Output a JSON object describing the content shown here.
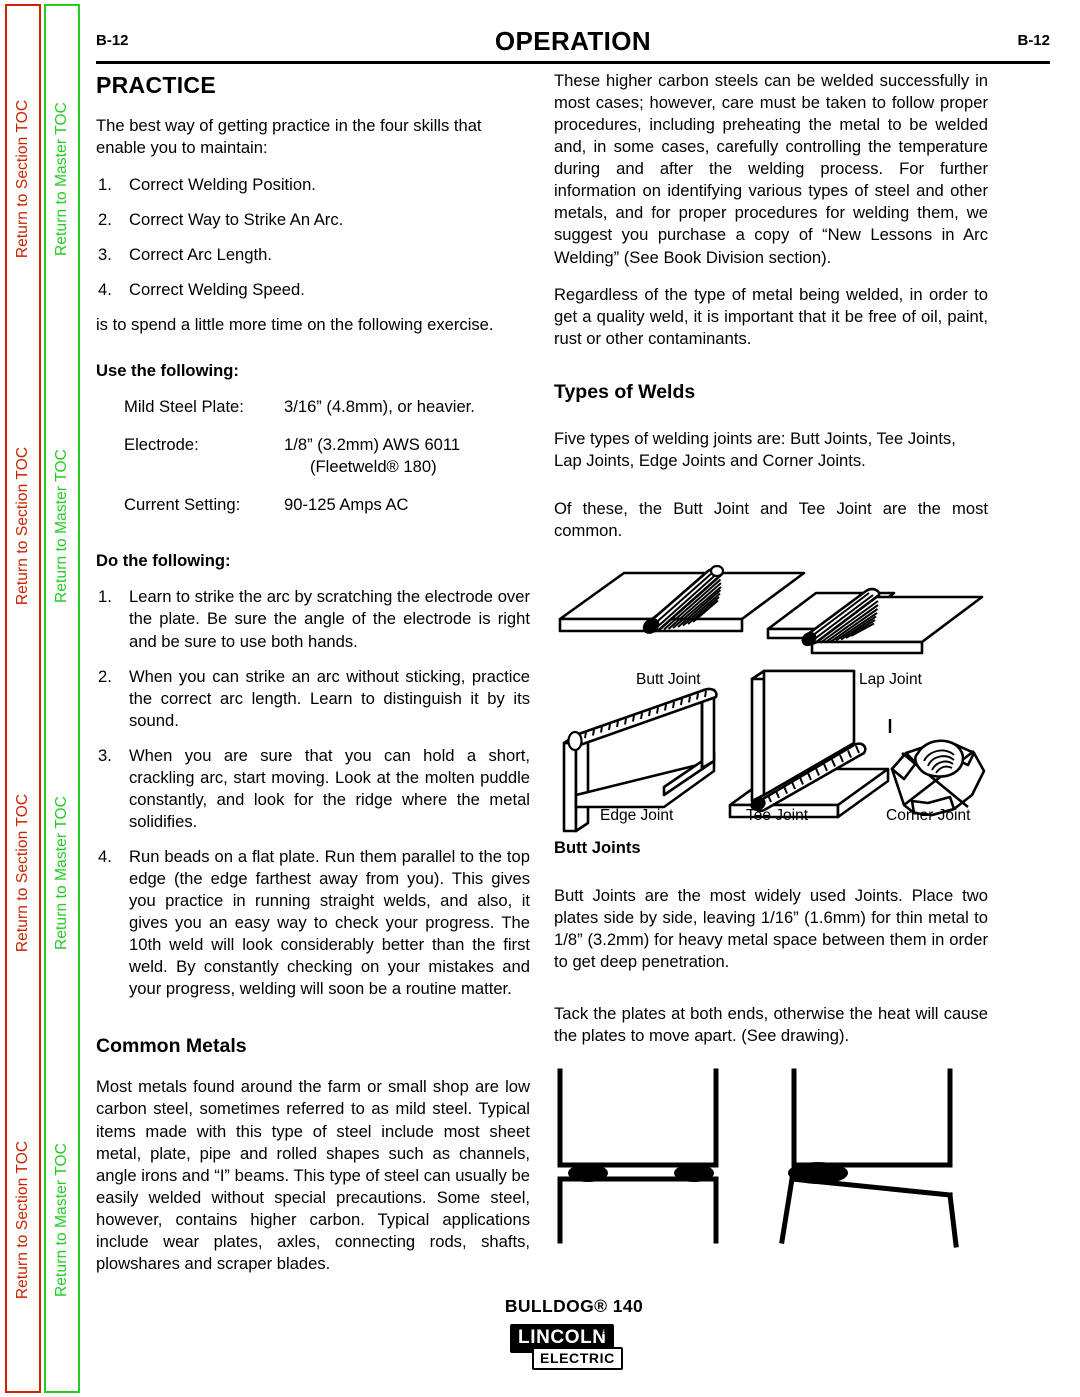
{
  "nav": {
    "section_tab_label": "Return to Section TOC",
    "master_tab_label": "Return to Master TOC",
    "section_tab_color": "#cc2200",
    "master_tab_color": "#22cc22",
    "repeat_count": 4
  },
  "header": {
    "page_number_left": "B-12",
    "title": "OPERATION",
    "page_number_right": "B-12"
  },
  "left_column": {
    "practice_heading": "PRACTICE",
    "intro": "The best way of getting practice in the four skills that enable you to maintain:",
    "skills": [
      {
        "num": "1.",
        "text": "Correct Welding Position."
      },
      {
        "num": "2.",
        "text": "Correct Way to Strike An Arc."
      },
      {
        "num": "3.",
        "text": "Correct Arc Length."
      },
      {
        "num": "4.",
        "text": "Correct Welding Speed."
      }
    ],
    "outro": "is to spend a little more time on the following exercise.",
    "use_heading": "Use the following:",
    "spec_rows": [
      {
        "key": "Mild Steel Plate:",
        "value": "3/16” (4.8mm), or heavier.",
        "value2": ""
      },
      {
        "key": "Electrode:",
        "value": "1/8” (3.2mm) AWS 6011",
        "value2": "(Fleetweld® 180)"
      },
      {
        "key": "Current Setting:",
        "value": "90-125 Amps AC",
        "value2": ""
      }
    ],
    "do_heading": "Do the following:",
    "steps": [
      {
        "num": "1.",
        "text": "Learn to strike the arc by scratching the electrode over the plate.  Be sure the angle of the electrode is right and be sure to use both hands."
      },
      {
        "num": "2.",
        "text": "When you can strike an arc without sticking, practice the correct arc length.  Learn to distinguish it by its sound."
      },
      {
        "num": "3.",
        "text": "When you are sure that you can hold a short, crackling arc, start moving.  Look at the molten puddle constantly, and look for the ridge where the metal solidifies."
      },
      {
        "num": "4.",
        "text": "Run beads on a flat plate.  Run them parallel to the top edge (the edge farthest away from you).  This gives you practice in running straight welds, and also, it gives you an easy way to check your progress.  The 10th weld will look considerably better than the first weld.  By constantly checking on your mistakes and your progress, welding will soon be a routine matter."
      }
    ],
    "common_metals_heading": "Common Metals",
    "common_metals_body": "Most metals found around the farm or small shop are low carbon steel, sometimes referred to as mild steel. Typical items made with this type of steel include most sheet metal, plate, pipe and rolled shapes such as channels, angle irons and “I” beams.  This type of steel can usually be easily welded without special  precautions.  Some steel, however, contains higher carbon. Typical applications include wear plates, axles, connecting rods, shafts, plowshares and scraper blades."
  },
  "right_column": {
    "carbon_steel_body": "These higher carbon steels can be welded successfully in most cases; however, care must be taken to follow proper procedures, including preheating the metal to be welded and, in some cases, carefully controlling the temperature during and after the welding process.  For further information on identifying various types of steel and other metals, and for proper procedures for welding them, we suggest you purchase a copy of “New Lessons in Arc Welding” (See Book Division section).",
    "contaminants_body": "Regardless of the type of metal being welded, in order to get a quality weld, it is important that it be free of oil, paint, rust or other contaminants.",
    "types_heading": "Types of Welds",
    "types_body": "Five types of welding joints are:  Butt Joints, Tee Joints, Lap Joints, Edge Joints and Corner Joints.",
    "common_body": "Of these, the Butt Joint and Tee Joint are the most common.",
    "figure_captions": {
      "butt": "Butt Joint",
      "lap": "Lap Joint",
      "edge": "Edge Joint",
      "tee": "Tee Joint",
      "corner": "Corner Joint"
    },
    "butt_joints_heading": "Butt Joints",
    "butt_joints_body": "Butt Joints are the most widely used Joints. Place two plates side by side, leaving 1/16” (1.6mm) for thin metal to 1/8” (3.2mm) for heavy metal space between them in order to get deep penetration.",
    "tack_body": "Tack the plates at both ends, otherwise the heat will cause the plates to move apart. (See drawing)."
  },
  "footer": {
    "model": "BULLDOG® 140",
    "logo_top": "LINCOLN",
    "logo_registered": "®",
    "logo_bottom": "ELECTRIC"
  }
}
